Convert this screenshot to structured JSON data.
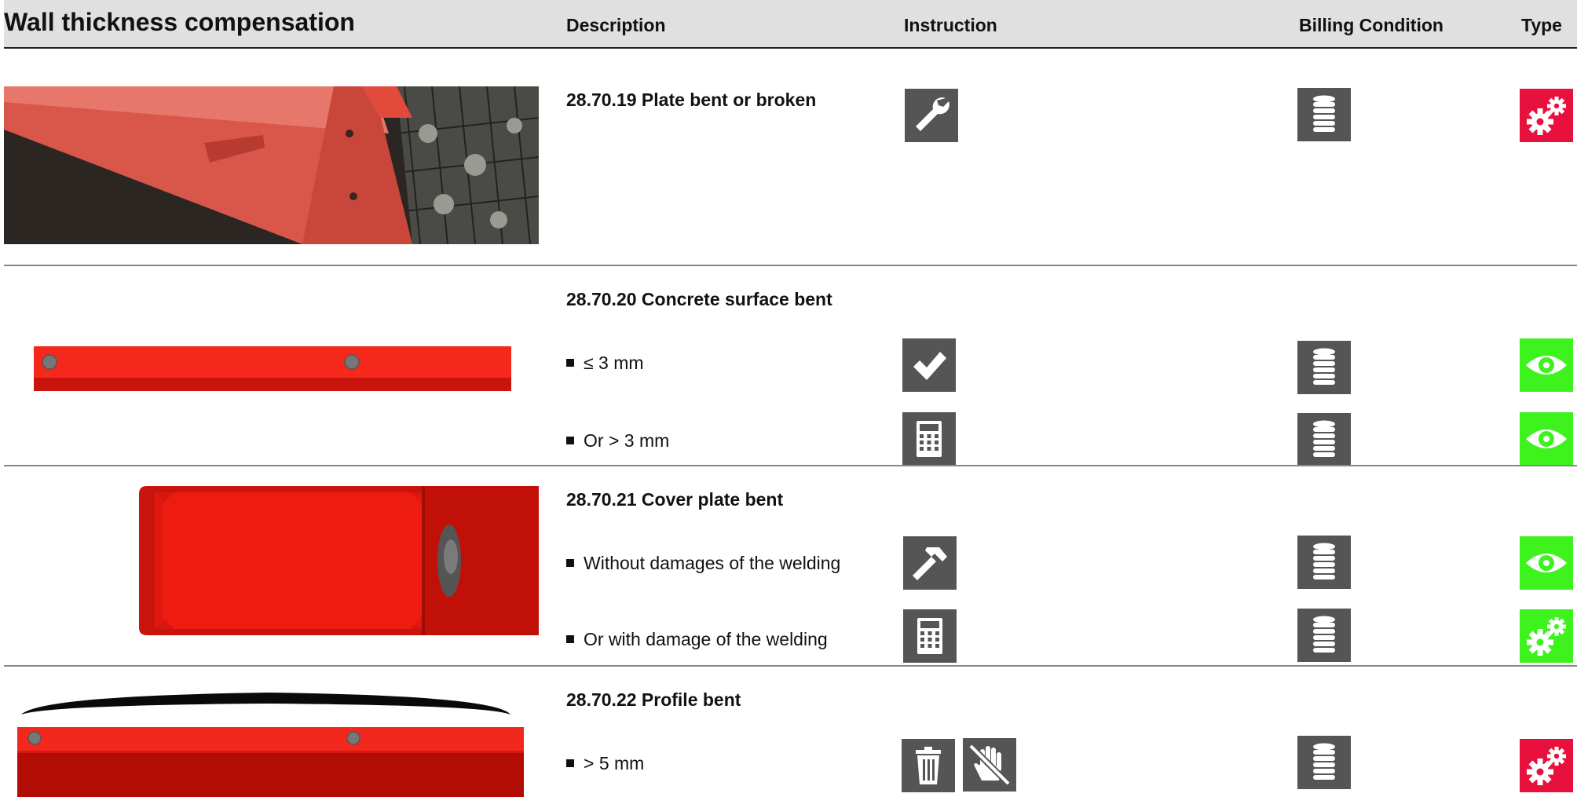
{
  "header": {
    "title": "Wall thickness compensation",
    "col_description": "Description",
    "col_instruction": "Instruction",
    "col_billing": "Billing Condition",
    "col_type": "Type"
  },
  "items": [
    {
      "title": "28.70.19 Plate bent or broken",
      "rows": [
        {
          "label": "",
          "instruction": [
            "wrench-icon"
          ],
          "billing": "coin-stack-icon",
          "type": "gears-icon",
          "type_color": "#e8103d"
        }
      ]
    },
    {
      "title": "28.70.20 Concrete surface bent",
      "rows": [
        {
          "label": "≤ 3 mm",
          "instruction": [
            "checkmark-icon"
          ],
          "billing": "coin-stack-icon",
          "type": "eye-icon",
          "type_color": "#3ef21e"
        },
        {
          "label": "Or > 3 mm",
          "instruction": [
            "calculator-icon"
          ],
          "billing": "coin-stack-icon",
          "type": "eye-icon",
          "type_color": "#3ef21e"
        }
      ]
    },
    {
      "title": "28.70.21 Cover plate bent",
      "rows": [
        {
          "label": "Without damages of the welding",
          "instruction": [
            "hammer-icon"
          ],
          "billing": "coin-stack-icon",
          "type": "eye-icon",
          "type_color": "#3ef21e"
        },
        {
          "label": "Or with damage of the welding",
          "instruction": [
            "calculator-icon"
          ],
          "billing": "coin-stack-icon",
          "type": "gears-icon",
          "type_color": "#3ef21e"
        }
      ]
    },
    {
      "title": "28.70.22 Profile bent",
      "rows": [
        {
          "label": "> 5 mm",
          "instruction": [
            "trash-icon",
            "no-touch-hand-icon"
          ],
          "billing": "coin-stack-icon",
          "type": "gears-icon",
          "type_color": "#e8103d"
        }
      ]
    }
  ]
}
